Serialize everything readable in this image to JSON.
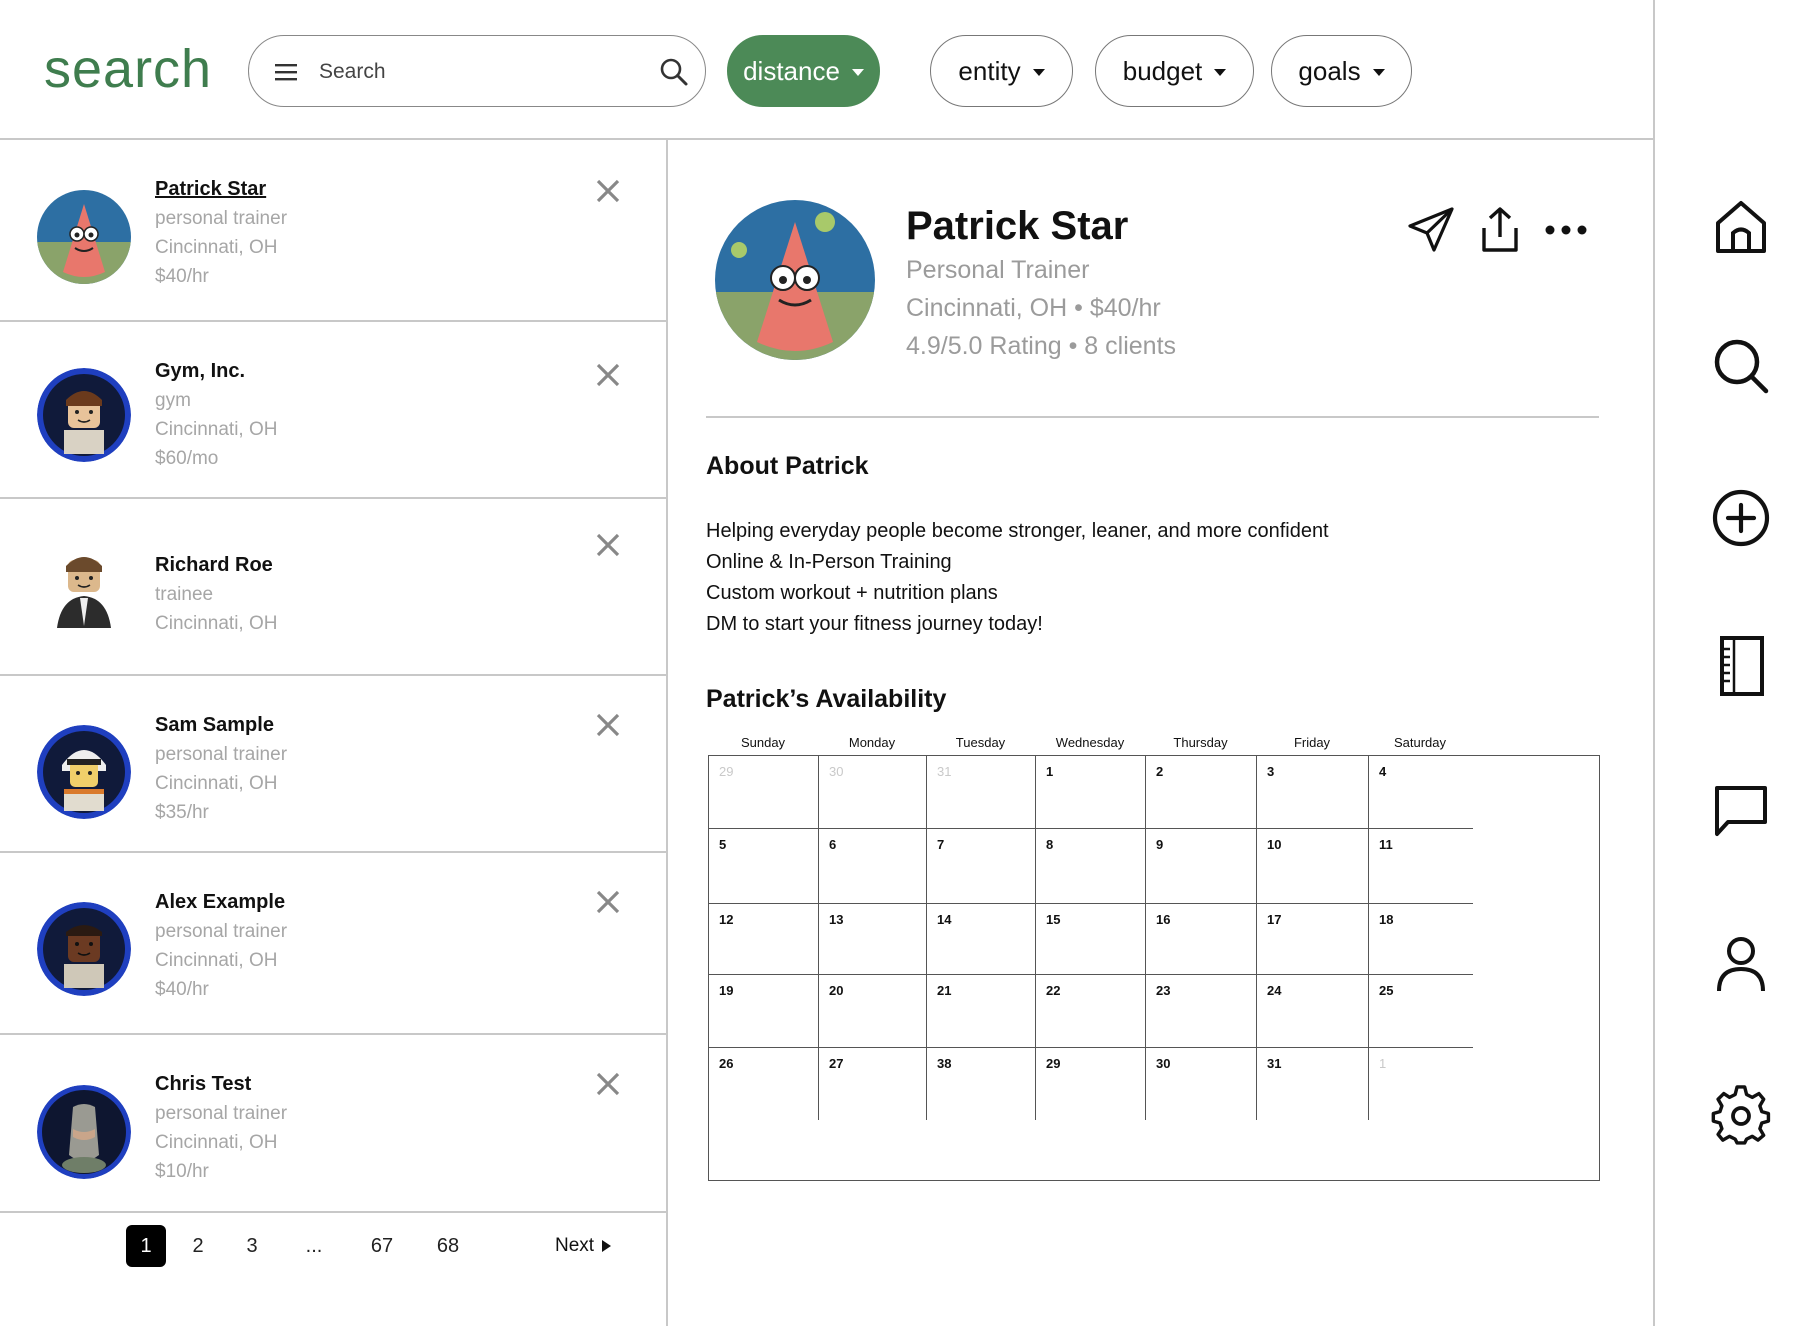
{
  "header": {
    "brand": "search",
    "search_placeholder": "Search",
    "filters": [
      {
        "label": "distance",
        "active": true
      },
      {
        "label": "entity",
        "active": false
      },
      {
        "label": "budget",
        "active": false
      },
      {
        "label": "goals",
        "active": false
      }
    ]
  },
  "results": [
    {
      "name": "Patrick Star",
      "lines": [
        "personal trainer",
        "Cincinnati, OH",
        "$40/hr"
      ],
      "selected": true
    },
    {
      "name": "Gym, Inc.",
      "lines": [
        "gym",
        "Cincinnati, OH",
        "$60/mo"
      ]
    },
    {
      "name": "Richard Roe",
      "lines": [
        "trainee",
        "Cincinnati, OH"
      ]
    },
    {
      "name": "Sam Sample",
      "lines": [
        "personal trainer",
        "Cincinnati, OH",
        "$35/hr"
      ]
    },
    {
      "name": "Alex Example",
      "lines": [
        "personal trainer",
        "Cincinnati, OH",
        "$40/hr"
      ]
    },
    {
      "name": "Chris Test",
      "lines": [
        "personal trainer",
        "Cincinnati, OH",
        "$10/hr"
      ]
    }
  ],
  "pagination": {
    "pages": [
      "1",
      "2",
      "3",
      "...",
      "67",
      "68"
    ],
    "current": "1",
    "next_label": "Next"
  },
  "profile": {
    "name": "Patrick Star",
    "role": "Personal Trainer",
    "location_rate": "Cincinnati, OH • $40/hr",
    "rating_clients": "4.9/5.0 Rating • 8 clients",
    "about_heading": "About Patrick",
    "about_lines": [
      "Helping everyday people become stronger, leaner, and more confident",
      "Online & In-Person Training",
      "Custom workout + nutrition plans",
      "DM to start your fitness journey today!"
    ],
    "availability_heading": "Patrick’s Availability"
  },
  "calendar": {
    "weekdays": [
      "Sunday",
      "Monday",
      "Tuesday",
      "Wednesday",
      "Thursday",
      "Friday",
      "Saturday"
    ],
    "weeks": [
      [
        {
          "d": "29",
          "muted": true
        },
        {
          "d": "30",
          "muted": true
        },
        {
          "d": "31",
          "muted": true
        },
        {
          "d": "1"
        },
        {
          "d": "2"
        },
        {
          "d": "3"
        },
        {
          "d": "4"
        }
      ],
      [
        {
          "d": "5"
        },
        {
          "d": "6"
        },
        {
          "d": "7"
        },
        {
          "d": "8"
        },
        {
          "d": "9"
        },
        {
          "d": "10"
        },
        {
          "d": "11"
        }
      ],
      [
        {
          "d": "12"
        },
        {
          "d": "13"
        },
        {
          "d": "14"
        },
        {
          "d": "15"
        },
        {
          "d": "16"
        },
        {
          "d": "17"
        },
        {
          "d": "18"
        }
      ],
      [
        {
          "d": "19"
        },
        {
          "d": "20"
        },
        {
          "d": "21"
        },
        {
          "d": "22"
        },
        {
          "d": "23"
        },
        {
          "d": "24"
        },
        {
          "d": "25"
        }
      ],
      [
        {
          "d": "26"
        },
        {
          "d": "27"
        },
        {
          "d": "38"
        },
        {
          "d": "29"
        },
        {
          "d": "30"
        },
        {
          "d": "31"
        },
        {
          "d": "1",
          "muted": true
        }
      ]
    ]
  },
  "icons": {
    "profile_actions": [
      "send-icon",
      "share-icon",
      "more-icon"
    ],
    "nav": [
      "home-icon",
      "search-icon",
      "add-icon",
      "notebook-icon",
      "message-icon",
      "profile-icon",
      "settings-icon"
    ]
  },
  "colors": {
    "accent": "#4c8a57",
    "brand": "#3f7d4e",
    "muted_text": "#a6a6a6",
    "avatar_ring": "#1f3fbf"
  }
}
